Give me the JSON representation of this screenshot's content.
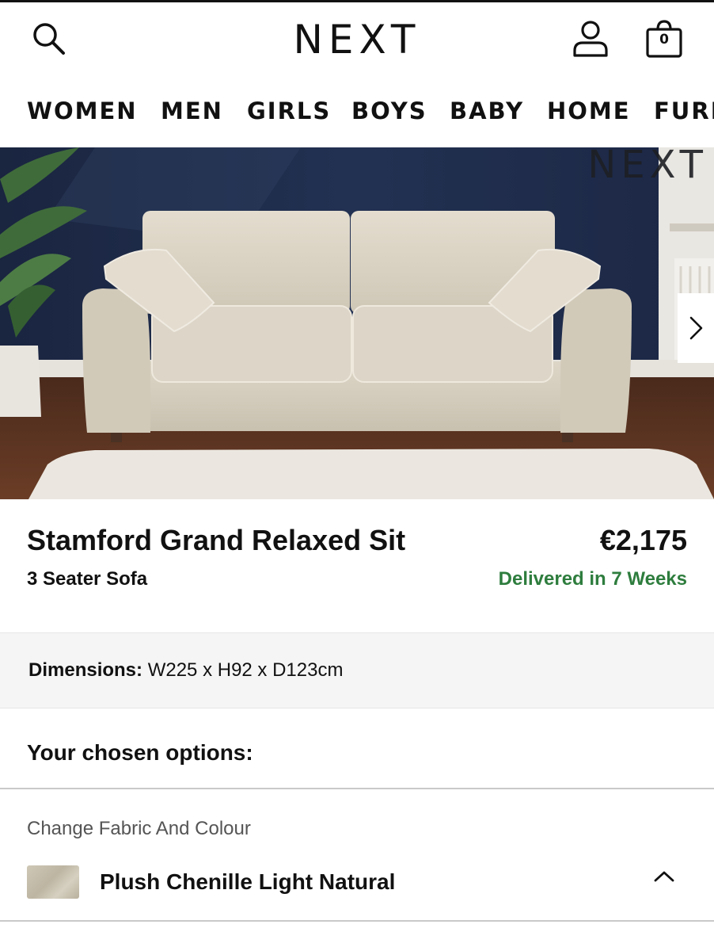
{
  "header": {
    "logo": "NEXT",
    "bag_count": "0"
  },
  "nav": {
    "items": [
      "WOMEN",
      "MEN",
      "GIRLS",
      "BOYS",
      "BABY",
      "HOME",
      "FURN"
    ]
  },
  "hero": {
    "watermark": "NEXT"
  },
  "product": {
    "name": "Stamford Grand Relaxed Sit",
    "subtitle": "3 Seater Sofa",
    "price": "€2,175",
    "delivery": "Delivered in 7 Weeks"
  },
  "dimensions": {
    "label": "Dimensions:",
    "value": " W225 x H92 x D123cm"
  },
  "options": {
    "title": "Your chosen options:",
    "fabric_label": "Change Fabric And Colour",
    "fabric_name": "Plush Chenille Light Natural"
  },
  "colors": {
    "delivery_green": "#2e7d3e",
    "wall_navy": "#1e2a44",
    "sofa_beige": "#d8d1c2"
  }
}
